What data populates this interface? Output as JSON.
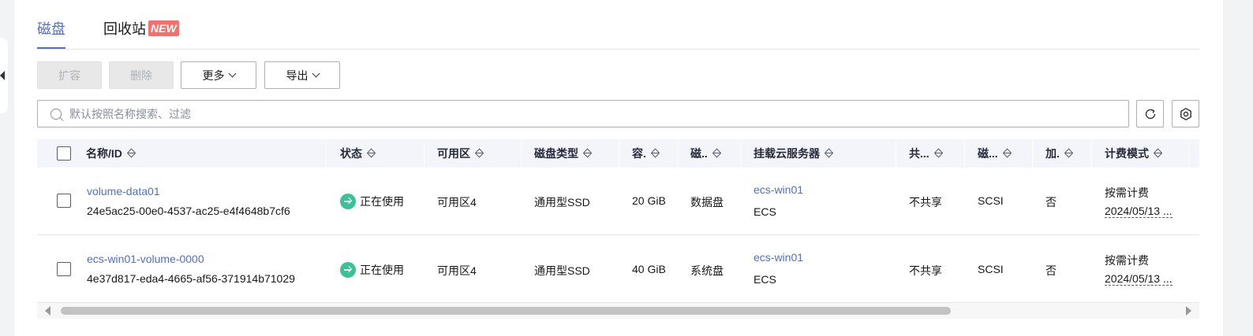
{
  "tabs": [
    {
      "label": "磁盘",
      "active": true
    },
    {
      "label": "回收站",
      "badge": "NEW"
    }
  ],
  "toolbar": {
    "expand": "扩容",
    "delete": "删除",
    "more": "更多",
    "export": "导出"
  },
  "search": {
    "placeholder": "默认按照名称搜索、过滤"
  },
  "columns": [
    "名称/ID",
    "状态",
    "可用区",
    "磁盘类型",
    "容.",
    "磁..",
    "挂载云服务器",
    "共...",
    "磁...",
    "加.",
    "计费模式"
  ],
  "rows": [
    {
      "name": "volume-data01",
      "id": "24e5ac25-00e0-4537-ac25-e4f4648b7cf6",
      "status": "正在使用",
      "az": "可用区4",
      "disk_type": "通用型SSD",
      "capacity": "20 GiB",
      "attribute": "数据盘",
      "server": "ecs-win01",
      "server_type": "ECS",
      "shared": "不共享",
      "mode": "SCSI",
      "encrypted": "否",
      "billing": "按需计费",
      "billing_date": "2024/05/13 ..."
    },
    {
      "name": "ecs-win01-volume-0000",
      "id": "4e37d817-eda4-4665-af56-371914b71029",
      "status": "正在使用",
      "az": "可用区4",
      "disk_type": "通用型SSD",
      "capacity": "40 GiB",
      "attribute": "系统盘",
      "server": "ecs-win01",
      "server_type": "ECS",
      "shared": "不共享",
      "mode": "SCSI",
      "encrypted": "否",
      "billing": "按需计费",
      "billing_date": "2024/05/13 ..."
    }
  ],
  "colors": {
    "accent": "#526ecc",
    "status_ok": "#3ac295",
    "badge": "#f66f6a"
  }
}
